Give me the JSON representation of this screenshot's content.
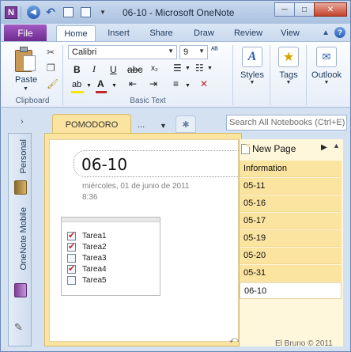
{
  "window": {
    "page_name": "06-10",
    "title_sep": " - ",
    "app_name": "Microsoft OneNote",
    "app_icon_letter": "N",
    "buttons": {
      "minimize": "─",
      "maximize": "□",
      "close": "✕"
    }
  },
  "ribbon_tabs": [
    {
      "label": "File"
    },
    {
      "label": "Home"
    },
    {
      "label": "Insert"
    },
    {
      "label": "Share"
    },
    {
      "label": "Draw"
    },
    {
      "label": "Review"
    },
    {
      "label": "View"
    }
  ],
  "ribbon": {
    "clipboard": {
      "paste_label": "Paste",
      "group_label": "Clipboard"
    },
    "basic_text": {
      "font": "Calibri",
      "size": "9",
      "group_label": "Basic Text"
    },
    "styles_label": "Styles",
    "tags_label": "Tags",
    "outlook_label": "Outlook"
  },
  "notebook_sidebar": {
    "notebooks": [
      {
        "name": "Personal"
      },
      {
        "name": "OneNote Mobile"
      }
    ]
  },
  "section": {
    "tab_label": "POMODORO",
    "more_label": "...",
    "new_tab_icon": "✱"
  },
  "search": {
    "placeholder": "Search All Notebooks (Ctrl+E)"
  },
  "page": {
    "title": "06-10",
    "date": "miércoles, 01 de junio de 2011",
    "time": "8:36",
    "tasks": [
      {
        "label": "Tarea1",
        "checked": true
      },
      {
        "label": "Tarea2",
        "checked": true
      },
      {
        "label": "Tarea3",
        "checked": false
      },
      {
        "label": "Tarea4",
        "checked": true
      },
      {
        "label": "Tarea5",
        "checked": false
      }
    ]
  },
  "pages_list": {
    "new_page_label": "New Page",
    "items": [
      {
        "label": "Information"
      },
      {
        "label": "05-11"
      },
      {
        "label": "05-16"
      },
      {
        "label": "05-17"
      },
      {
        "label": "05-19"
      },
      {
        "label": "05-20"
      },
      {
        "label": "05-31"
      },
      {
        "label": "06-10"
      }
    ],
    "current": "06-10"
  },
  "watermark": "El Bruno © 2011",
  "colors": {
    "file_tab": "#7a3a9a",
    "section_tab": "#fbe3a0",
    "check_mark": "#c1272d",
    "page_selected": "#ffffff"
  }
}
